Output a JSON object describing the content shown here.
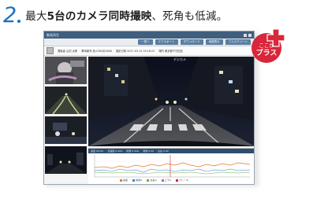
{
  "headline": {
    "number": "2",
    "text_prefix": "最大",
    "text_bold": "5台のカメラ同時撮映",
    "text_suffix": "、死角も低減。"
  },
  "badge": {
    "line1": "ここが",
    "line2": "プラス"
  },
  "window": {
    "title": "動画再生"
  },
  "toolbar": {
    "buttons": [
      "一覧へ",
      "エクスポート",
      "ダウンロード",
      "地図表示",
      "フルスクリーン"
    ]
  },
  "info": {
    "driver": "運転者 山田 太郎",
    "vehicle": "車両番号 品川300あ0000",
    "date": "撮影日時 2017-03-14 19:18:22",
    "place": "場所 東京都千代田区",
    "overlay_label": "デジカメ"
  },
  "graph": {
    "header_items": [
      "速度 0km/h",
      "加速度 0.00G",
      "衝撃 0.00G",
      "前後 0.00",
      "左右 0.00"
    ],
    "legend": [
      "速度",
      "前後G",
      "左右G",
      "上下G",
      "ブレーキ"
    ]
  },
  "colors": {
    "accent": "#1a6fc4",
    "badge_red": "#d8263a",
    "titlebar": "#3f5f7f"
  }
}
